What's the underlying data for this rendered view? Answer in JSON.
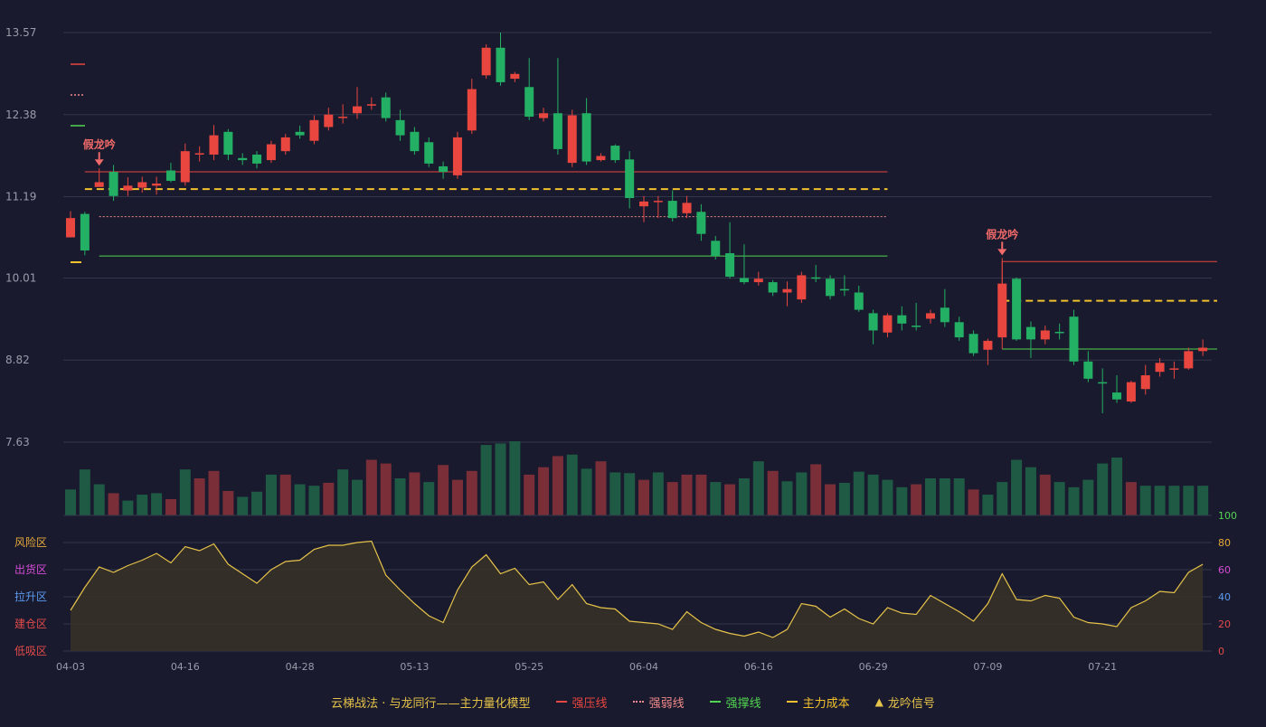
{
  "colors": {
    "background": "#191a2d",
    "up": "#e8463f",
    "down": "#23b064",
    "strong_pressure": "#e8463f",
    "weak_pressure": "#f08a8a",
    "support": "#52d452",
    "main_cost": "#f2c12e",
    "risk_line": "#e6c34a",
    "grid": "#33364a",
    "axis_text": "#9a9cab"
  },
  "legend": {
    "title": "云梯战法 · 与龙同行——主力量化模型",
    "items": [
      {
        "label": "强压线",
        "color": "#e8463f",
        "style": "solid"
      },
      {
        "label": "强弱线",
        "color": "#f08a8a",
        "style": "dotted"
      },
      {
        "label": "强撑线",
        "color": "#52d452",
        "style": "solid"
      },
      {
        "label": "主力成本",
        "color": "#f2c12e",
        "style": "dashed"
      },
      {
        "label": "龙吟信号",
        "color": "#e6c34a",
        "style": "triangle"
      }
    ]
  },
  "chart_data": [
    {
      "type": "candlestick",
      "y_ticks": [
        "13.57",
        "12.38",
        "11.19",
        "10.01",
        "8.82",
        "7.63"
      ],
      "ylim": [
        7.63,
        13.57
      ],
      "x_ticks": [
        "04-03",
        "04-16",
        "04-28",
        "05-13",
        "05-25",
        "06-04",
        "06-16",
        "06-29",
        "07-09",
        "07-21"
      ],
      "x_tick_index": [
        0,
        8,
        16,
        24,
        32,
        40,
        48,
        56,
        64,
        72
      ],
      "ohlc": [
        [
          10.6,
          10.88,
          10.6,
          10.98
        ],
        [
          10.94,
          10.41,
          10.34,
          10.97
        ],
        [
          11.33,
          11.4,
          11.38,
          11.6
        ],
        [
          11.55,
          11.2,
          11.13,
          11.65
        ],
        [
          11.28,
          11.35,
          11.2,
          11.47
        ],
        [
          11.32,
          11.4,
          11.25,
          11.48
        ],
        [
          11.35,
          11.38,
          11.22,
          11.48
        ],
        [
          11.57,
          11.42,
          11.4,
          11.68
        ],
        [
          11.4,
          11.85,
          11.35,
          11.96
        ],
        [
          11.8,
          11.82,
          11.7,
          11.92
        ],
        [
          11.8,
          12.08,
          11.72,
          12.23
        ],
        [
          12.13,
          11.8,
          11.72,
          12.17
        ],
        [
          11.75,
          11.72,
          11.65,
          11.82
        ],
        [
          11.8,
          11.67,
          11.6,
          11.85
        ],
        [
          11.72,
          11.95,
          11.68,
          12.0
        ],
        [
          11.85,
          12.05,
          11.8,
          12.1
        ],
        [
          12.13,
          12.08,
          12.03,
          12.22
        ],
        [
          12.0,
          12.3,
          11.95,
          12.37
        ],
        [
          12.2,
          12.38,
          12.15,
          12.48
        ],
        [
          12.33,
          12.35,
          12.25,
          12.53
        ],
        [
          12.4,
          12.5,
          12.32,
          12.78
        ],
        [
          12.51,
          12.53,
          12.45,
          12.63
        ],
        [
          12.63,
          12.33,
          12.28,
          12.7
        ],
        [
          12.3,
          12.08,
          12.0,
          12.45
        ],
        [
          12.13,
          11.85,
          11.8,
          12.2
        ],
        [
          11.98,
          11.67,
          11.62,
          12.05
        ],
        [
          11.63,
          11.55,
          11.45,
          11.7
        ],
        [
          11.5,
          12.05,
          11.45,
          12.13
        ],
        [
          12.15,
          12.75,
          12.1,
          12.9
        ],
        [
          12.95,
          13.35,
          12.9,
          13.4
        ],
        [
          13.35,
          12.85,
          12.8,
          13.57
        ],
        [
          12.9,
          12.97,
          12.85,
          13.0
        ],
        [
          12.78,
          12.35,
          12.3,
          13.2
        ],
        [
          12.33,
          12.4,
          12.28,
          12.48
        ],
        [
          12.4,
          11.88,
          11.8,
          13.2
        ],
        [
          11.68,
          12.37,
          11.62,
          12.45
        ],
        [
          12.4,
          11.7,
          11.65,
          12.62
        ],
        [
          11.72,
          11.78,
          11.7,
          11.82
        ],
        [
          11.93,
          11.72,
          11.68,
          11.95
        ],
        [
          11.73,
          11.17,
          11.02,
          11.85
        ],
        [
          11.05,
          11.12,
          10.82,
          11.2
        ],
        [
          11.12,
          11.13,
          10.88,
          11.2
        ],
        [
          11.13,
          10.88,
          10.83,
          11.28
        ],
        [
          10.95,
          11.1,
          10.88,
          11.2
        ],
        [
          10.97,
          10.65,
          10.55,
          11.08
        ],
        [
          10.55,
          10.33,
          10.28,
          10.62
        ],
        [
          10.37,
          10.03,
          10.0,
          10.82
        ],
        [
          10.01,
          9.95,
          9.92,
          10.5
        ],
        [
          9.95,
          10.0,
          9.9,
          10.1
        ],
        [
          9.95,
          9.8,
          9.75,
          9.98
        ],
        [
          9.8,
          9.85,
          9.6,
          9.96
        ],
        [
          9.7,
          10.05,
          9.65,
          10.1
        ],
        [
          10.02,
          10.0,
          9.95,
          10.2
        ],
        [
          10.0,
          9.75,
          9.7,
          10.05
        ],
        [
          9.85,
          9.84,
          9.75,
          10.05
        ],
        [
          9.8,
          9.55,
          9.52,
          9.9
        ],
        [
          9.5,
          9.25,
          9.05,
          9.55
        ],
        [
          9.22,
          9.47,
          9.15,
          9.5
        ],
        [
          9.47,
          9.35,
          9.25,
          9.6
        ],
        [
          9.32,
          9.3,
          9.25,
          9.65
        ],
        [
          9.42,
          9.5,
          9.35,
          9.55
        ],
        [
          9.58,
          9.37,
          9.3,
          9.85
        ],
        [
          9.37,
          9.15,
          9.1,
          9.45
        ],
        [
          9.2,
          8.92,
          8.88,
          9.25
        ],
        [
          8.97,
          9.1,
          8.75,
          9.13
        ],
        [
          9.15,
          9.93,
          9.12,
          10.3
        ],
        [
          10.0,
          9.12,
          9.1,
          10.02
        ],
        [
          9.3,
          9.12,
          8.85,
          9.38
        ],
        [
          9.12,
          9.25,
          9.05,
          9.32
        ],
        [
          9.23,
          9.22,
          9.12,
          9.35
        ],
        [
          9.45,
          8.8,
          8.75,
          9.55
        ],
        [
          8.8,
          8.55,
          8.5,
          8.95
        ],
        [
          8.5,
          8.48,
          8.05,
          8.7
        ],
        [
          8.35,
          8.25,
          8.2,
          8.6
        ],
        [
          8.22,
          8.5,
          8.2,
          8.52
        ],
        [
          8.4,
          8.6,
          8.32,
          8.75
        ],
        [
          8.65,
          8.78,
          8.58,
          8.85
        ],
        [
          8.7,
          8.7,
          8.55,
          8.8
        ],
        [
          8.7,
          8.95,
          8.68,
          9.0
        ],
        [
          8.95,
          9.0,
          8.88,
          9.12
        ]
      ],
      "lines": [
        {
          "name": "强压线",
          "segments": [
            [
              1,
              57,
              11.55
            ],
            [
              65,
              80,
              10.25
            ]
          ]
        },
        {
          "name": "强弱线",
          "segments": [
            [
              2,
              57,
              10.9
            ]
          ]
        },
        {
          "name": "强撑线",
          "segments": [
            [
              2,
              57,
              10.33
            ],
            [
              65,
              80,
              8.98
            ]
          ]
        },
        {
          "name": "主力成本",
          "segments": [
            [
              1,
              57,
              11.3
            ],
            [
              65,
              80,
              9.68
            ]
          ]
        }
      ],
      "signals": [
        {
          "label": "假龙吟",
          "index": 2
        },
        {
          "label": "假龙吟",
          "index": 65
        }
      ]
    },
    {
      "type": "bar",
      "volumes": [
        35,
        62,
        42,
        30,
        20,
        28,
        30,
        22,
        62,
        50,
        60,
        33,
        25,
        32,
        55,
        55,
        42,
        40,
        44,
        62,
        48,
        75,
        70,
        50,
        58,
        45,
        68,
        48,
        60,
        95,
        97,
        100,
        55,
        65,
        80,
        82,
        63,
        73,
        58,
        57,
        48,
        58,
        45,
        55,
        55,
        45,
        42,
        50,
        73,
        60,
        46,
        58,
        69,
        42,
        44,
        59,
        55,
        48,
        38,
        42,
        50,
        50,
        50,
        35,
        28,
        45,
        75,
        65,
        55,
        45,
        38,
        48,
        70,
        78,
        45,
        40,
        40,
        40,
        40,
        40
      ],
      "down_indices": [
        0,
        1,
        2,
        4,
        5,
        6,
        8,
        12,
        13,
        14,
        16,
        17,
        19,
        20,
        23,
        25,
        29,
        30,
        31,
        35,
        36,
        38,
        39,
        41,
        45,
        47,
        48,
        50,
        51,
        54,
        55,
        56,
        57,
        58,
        60,
        61,
        62,
        64,
        65,
        66,
        67,
        69,
        70,
        71,
        72,
        73,
        75,
        76,
        77,
        78,
        79
      ]
    },
    {
      "type": "area",
      "y_ticks": [
        "100",
        "80",
        "60",
        "40",
        "20",
        "0"
      ],
      "y_tick_colors": [
        "#52d452",
        "#e6a93a",
        "#d54bd5",
        "#5b9bf0",
        "#e24b4b",
        "#e24b4b"
      ],
      "zones": [
        {
          "label": "风险区",
          "color": "#e6a93a"
        },
        {
          "label": "出货区",
          "color": "#d54bd5"
        },
        {
          "label": "拉升区",
          "color": "#5b9bf0"
        },
        {
          "label": "建仓区",
          "color": "#e24b4b"
        },
        {
          "label": "低吸区",
          "color": "#e24b4b"
        }
      ],
      "ylim": [
        0,
        100
      ],
      "values": [
        30,
        47,
        62,
        58,
        63,
        67,
        72,
        65,
        77,
        74,
        79,
        64,
        57,
        50,
        60,
        66,
        67,
        75,
        78,
        78,
        80,
        81,
        56,
        45,
        35,
        26,
        21,
        45,
        62,
        71,
        57,
        61,
        49,
        51,
        38,
        49,
        35,
        32,
        31,
        22,
        21,
        20,
        16,
        29,
        21,
        16,
        13,
        11,
        14,
        10,
        16,
        35,
        33,
        25,
        31,
        24,
        20,
        32,
        28,
        27,
        41,
        35,
        29,
        22,
        35,
        57,
        38,
        37,
        41,
        39,
        25,
        21,
        20,
        18,
        32,
        37,
        44,
        43,
        58,
        64
      ]
    }
  ]
}
